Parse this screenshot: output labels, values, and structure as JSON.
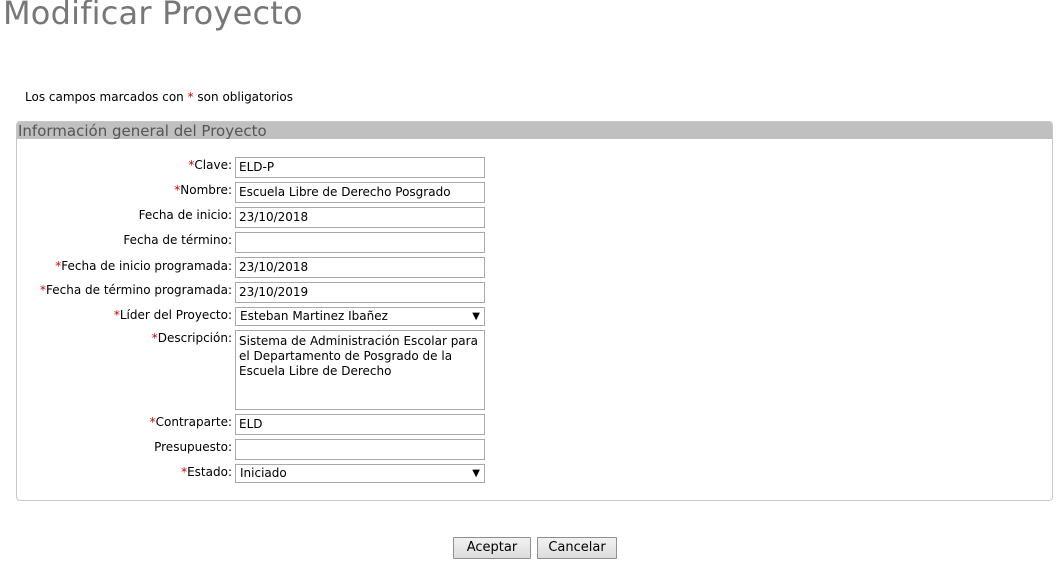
{
  "page": {
    "title": "Modificar Proyecto",
    "required_note": "Los campos marcados con * son obligatorios",
    "required_note_prefix": "Los campos marcados con ",
    "required_note_star": "*",
    "required_note_suffix": " son obligatorios"
  },
  "section": {
    "title": "Información general del Proyecto"
  },
  "form": {
    "clave": {
      "label": "Clave:",
      "required": true,
      "value": ""
    },
    "nombre": {
      "label": "Nombre:",
      "required": true,
      "value": "Escuela Libre de Derecho Posgrado"
    },
    "fecha_inicio": {
      "label": "Fecha de inicio:",
      "required": false,
      "value": "23/10/2018"
    },
    "fecha_termino": {
      "label": "Fecha de término:",
      "required": false,
      "value": ""
    },
    "fecha_inicio_programada": {
      "label": "Fecha de inicio programada:",
      "required": true,
      "value": "23/10/2018"
    },
    "fecha_termino_programada": {
      "label": "Fecha de término programada:",
      "required": true,
      "value": "23/10/2019"
    },
    "lider": {
      "label": "Líder del Proyecto:",
      "required": true,
      "value": "Esteban Martinez Ibañez"
    },
    "descripcion": {
      "label": "Descripción:",
      "required": true,
      "value": "Sistema de Administración Escolar para\nel Departamento de Posgrado de la\nEscuela Libre de Derecho"
    },
    "contraparte": {
      "label": "Contraparte:",
      "required": true,
      "value": "ELD"
    },
    "presupuesto": {
      "label": "Presupuesto:",
      "required": false,
      "value": ""
    },
    "estado": {
      "label": "Estado:",
      "required": true,
      "value": "Iniciado"
    },
    "star": "*"
  },
  "buttons": {
    "accept": "Aceptar",
    "cancel": "Cancelar"
  }
}
